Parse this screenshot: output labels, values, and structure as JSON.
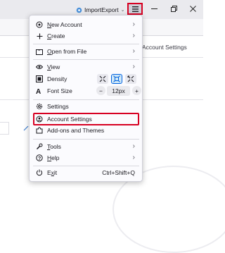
{
  "window": {
    "addon_button_label": "ImportExport",
    "icons": {
      "addon": "addon-icon",
      "menu": "hamburger-menu-icon",
      "minimize": "minimize-icon",
      "restore": "restore-icon",
      "close": "close-icon"
    }
  },
  "background": {
    "account_settings_text": "Account Settings"
  },
  "menu": {
    "new_account": {
      "pre": "",
      "key": "N",
      "rest": "ew Account"
    },
    "create": {
      "pre": "",
      "key": "C",
      "rest": "reate"
    },
    "open_from_file": {
      "pre": "",
      "key": "O",
      "rest": "pen from File"
    },
    "view": {
      "pre": "",
      "key": "V",
      "rest": "iew"
    },
    "density": {
      "label": "Density"
    },
    "font_size": {
      "label": "Font Size",
      "value": "12px",
      "decrease": "−",
      "increase": "+"
    },
    "settings": {
      "label": "Settings"
    },
    "account_settings": {
      "label": "Account Settings"
    },
    "addons_and_themes": {
      "label": "Add-ons and Themes"
    },
    "tools": {
      "pre": "",
      "key": "T",
      "rest": "ools"
    },
    "help": {
      "pre": "",
      "key": "H",
      "rest": "elp"
    },
    "exit": {
      "pre": "E",
      "key": "x",
      "rest": "it",
      "shortcut": "Ctrl+Shift+Q"
    }
  },
  "colors": {
    "highlight": "#d70022",
    "accent": "#0061e0"
  }
}
